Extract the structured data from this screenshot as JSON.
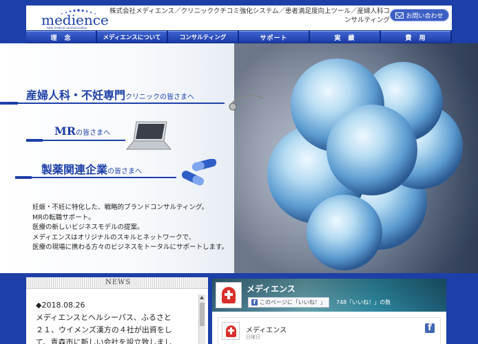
{
  "header": {
    "logo_text": "medience",
    "logo_tagline": "total medical communication",
    "tagline": "株式会社メディエンス／クリニッククチコミ強化システム／患者満足度向上ツール／産婦人科コンサルティング",
    "contact_label": "お問い合わせ"
  },
  "nav": {
    "items": [
      "理　念",
      "メディエンスについて",
      "コンサルティング",
      "サポート",
      "実　績",
      "費　用"
    ]
  },
  "hero": {
    "line1_main": "産婦人科・不妊専門",
    "line1_sub": "クリニックの皆さまへ",
    "line2_main": "MR",
    "line2_sub": "の皆さまへ",
    "line3_main": "製薬関連企業",
    "line3_sub": "の皆さまへ",
    "description": [
      "妊娠・不妊に特化した、戦略的ブランドコンサルティング。",
      "MRの転職サポート。",
      "医療の新しいビジネスモデルの提案。",
      "メディエンスはオリジナルのスキルとネットワークで、",
      "医療の現場に携わる方々のビジネスをトータルにサポートします。"
    ]
  },
  "news": {
    "heading": "NEWS",
    "date": "◆2018.08.26",
    "lines": [
      "メディエンスとヘルシーパス、ふるさと",
      "２１、ウイメンズ漢方の４社が出資をし",
      "て、青森市に新しい会社を設立致しまし"
    ]
  },
  "facebook": {
    "page_name": "メディエンス",
    "like_label": "このページに「いいね！」",
    "like_count": "748「いいね！」の数",
    "post_name": "メディエンス",
    "post_date": "日曜日",
    "colors": {
      "brand": "#4267b2"
    }
  },
  "colors": {
    "primary": "#1d3fa8",
    "nav_dark": "#0d2a8a"
  }
}
